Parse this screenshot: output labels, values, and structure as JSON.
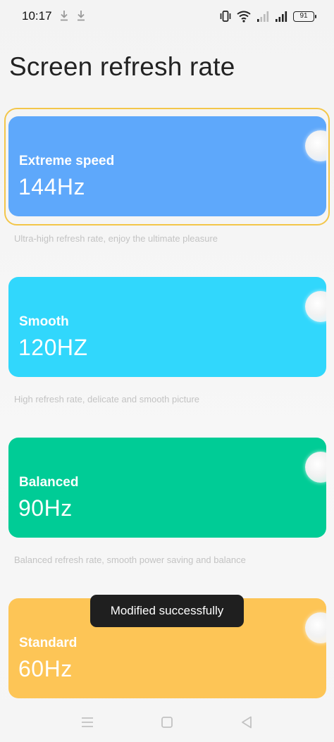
{
  "status_bar": {
    "time": "10:17",
    "battery": "91",
    "icons": [
      "download-icon",
      "download-icon",
      "vibrate-icon",
      "wifi-icon",
      "signal-icon",
      "signal-icon",
      "battery-icon"
    ]
  },
  "title": "Screen refresh rate",
  "options": [
    {
      "name": "Extreme speed",
      "rate": "144Hz",
      "description": "Ultra-high refresh rate, enjoy the ultimate pleasure",
      "color": "#5ea8fb",
      "selected": true
    },
    {
      "name": "Smooth",
      "rate": "120HZ",
      "description": "High refresh rate, delicate and smooth picture",
      "color": "#31d7fc",
      "selected": false
    },
    {
      "name": "Balanced",
      "rate": "90Hz",
      "description": "Balanced refresh rate, smooth power saving and balance",
      "color": "#00cc96",
      "selected": false
    },
    {
      "name": "Standard",
      "rate": "60Hz",
      "description": "",
      "color": "#fdc556",
      "selected": false
    }
  ],
  "toast": "Modified successfully",
  "selection_color": "#f3c649",
  "nav_bar": {
    "icons": [
      "menu-icon",
      "home-icon",
      "back-icon"
    ]
  }
}
